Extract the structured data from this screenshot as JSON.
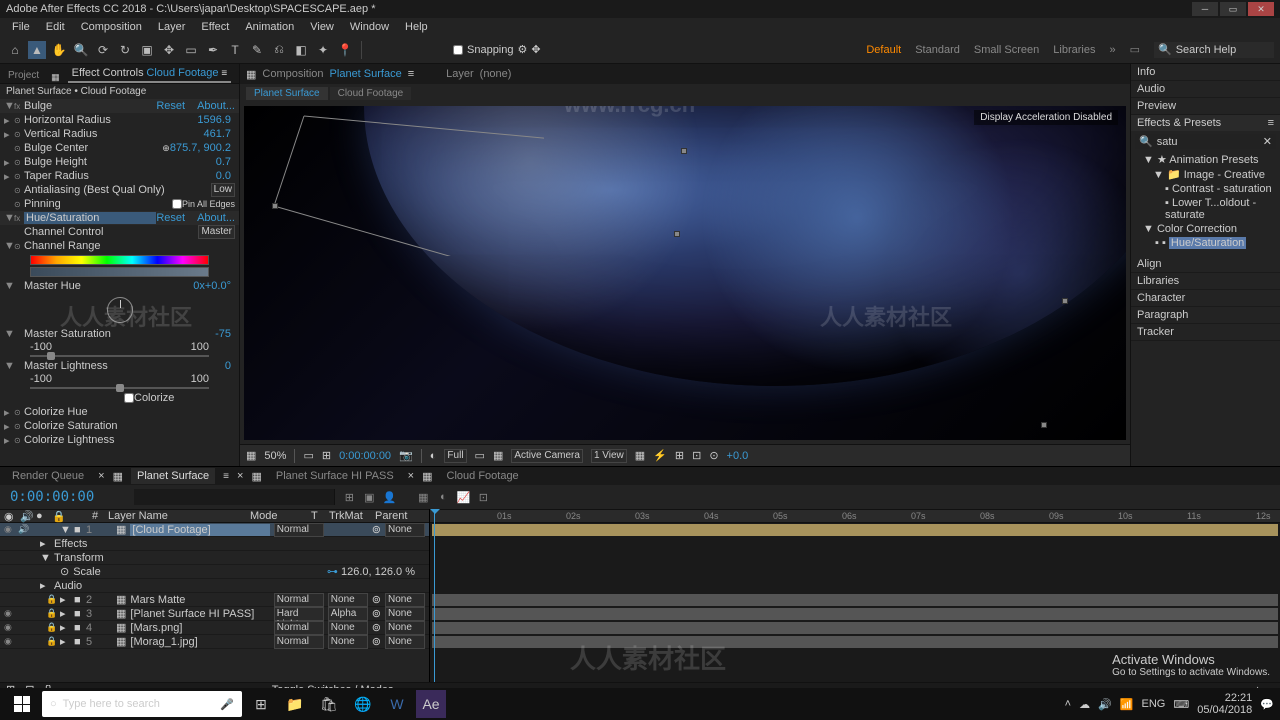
{
  "title_bar": "Adobe After Effects CC 2018 - C:\\Users\\japar\\Desktop\\SPACESCAPE.aep *",
  "menu": [
    "File",
    "Edit",
    "Composition",
    "Layer",
    "Effect",
    "Animation",
    "View",
    "Window",
    "Help"
  ],
  "snapping_label": "Snapping",
  "workspaces": {
    "active": "Default",
    "items": [
      "Default",
      "Standard",
      "Small Screen",
      "Libraries"
    ]
  },
  "search_help": "Search Help",
  "left_panel": {
    "tabs": {
      "project": "Project",
      "effect_controls": "Effect Controls",
      "layer_ref": "Cloud Footage"
    },
    "breadcrumb": "Planet Surface • Cloud Footage",
    "fx_bulge": {
      "name": "Bulge",
      "reset": "Reset",
      "about": "About...",
      "horiz_radius": {
        "label": "Horizontal Radius",
        "val": "1596.9"
      },
      "vert_radius": {
        "label": "Vertical Radius",
        "val": "461.7"
      },
      "center": {
        "label": "Bulge Center",
        "val": "875.7, 900.2"
      },
      "height": {
        "label": "Bulge Height",
        "val": "0.7"
      },
      "taper": {
        "label": "Taper Radius",
        "val": "0.0"
      },
      "antialias": {
        "label": "Antialiasing (Best Qual Only)",
        "val": "Low"
      },
      "pinning": {
        "label": "Pinning",
        "checkbox": "Pin All Edges"
      }
    },
    "fx_hue": {
      "name": "Hue/Saturation",
      "reset": "Reset",
      "about": "About...",
      "channel_control": {
        "label": "Channel Control",
        "val": "Master"
      },
      "channel_range": "Channel Range",
      "master_hue": {
        "label": "Master Hue",
        "val": "0x+0.0°"
      },
      "master_sat": {
        "label": "Master Saturation",
        "val": "-75",
        "min": "-100",
        "max": "100"
      },
      "master_light": {
        "label": "Master Lightness",
        "val": "0",
        "min": "-100",
        "max": "100"
      },
      "colorize_label": "Colorize",
      "colorize_hue": "Colorize Hue",
      "colorize_sat": "Colorize Saturation",
      "colorize_light": "Colorize Lightness"
    }
  },
  "viewer": {
    "composition_label": "Composition",
    "composition_name": "Planet Surface",
    "layer_label": "Layer",
    "layer_none": "(none)",
    "subtabs": [
      "Planet Surface",
      "Cloud Footage"
    ],
    "accel_badge": "Display Acceleration Disabled",
    "footer": {
      "zoom": "50%",
      "timecode": "0:00:00:00",
      "res": "Full",
      "camera": "Active Camera",
      "view": "1 View",
      "exposure": "+0.0"
    }
  },
  "right_panel": {
    "info": "Info",
    "audio": "Audio",
    "preview": "Preview",
    "effects_presets": "Effects & Presets",
    "search_val": "satu",
    "tree": {
      "root": "Animation Presets",
      "l1": "Image - Creative",
      "i1": "Contrast - saturation",
      "i2": "Lower T...oldout - saturate",
      "l2": "Color Correction",
      "sel": "Hue/Saturation"
    },
    "align": "Align",
    "libraries": "Libraries",
    "character": "Character",
    "paragraph": "Paragraph",
    "tracker": "Tracker"
  },
  "timeline": {
    "tabs": [
      "Render Queue",
      "Planet Surface",
      "Planet Surface HI PASS",
      "Cloud Footage"
    ],
    "timecode": "0:00:00:00",
    "search_placeholder": "",
    "columns": {
      "layer_name": "Layer Name",
      "mode": "Mode",
      "trkmat": "TrkMat",
      "parent": "Parent"
    },
    "layers": [
      {
        "num": "1",
        "name": "[Cloud Footage]",
        "mode": "Normal",
        "trk": "",
        "parent": "None",
        "selected": true,
        "eye": true,
        "lock": false
      },
      {
        "expand": "Effects"
      },
      {
        "expand": "Transform",
        "scale_label": "Scale",
        "scale_val": "126.0, 126.0 %"
      },
      {
        "audio": "Audio"
      },
      {
        "num": "2",
        "name": "Mars Matte",
        "mode": "Normal",
        "trk": "None",
        "parent": "None",
        "eye": false,
        "lock": true
      },
      {
        "num": "3",
        "name": "[Planet Surface HI PASS]",
        "mode": "Hard Light",
        "trk": "Alpha",
        "parent": "None",
        "eye": true,
        "lock": true
      },
      {
        "num": "4",
        "name": "[Mars.png]",
        "mode": "Normal",
        "trk": "None",
        "parent": "None",
        "eye": true,
        "lock": true
      },
      {
        "num": "5",
        "name": "[Morag_1.jpg]",
        "mode": "Normal",
        "trk": "None",
        "parent": "None",
        "eye": true,
        "lock": true
      }
    ],
    "ruler_ticks": [
      "01s",
      "02s",
      "03s",
      "04s",
      "05s",
      "06s",
      "07s",
      "08s",
      "09s",
      "10s",
      "11s",
      "12s"
    ],
    "toggle_label": "Toggle Switches / Modes"
  },
  "activate": {
    "line1": "Activate Windows",
    "line2": "Go to Settings to activate Windows."
  },
  "taskbar": {
    "search": "Type here to search",
    "time": "22:21",
    "date": "05/04/2018",
    "lang": "ENG"
  },
  "watermarks": {
    "url": "www.rrcg.cn",
    "text": "人人素材社区"
  }
}
